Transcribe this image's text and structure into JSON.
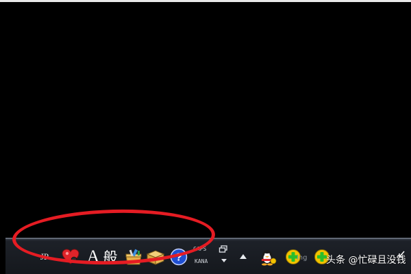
{
  "langbar": {
    "mode_label": "JP",
    "input_char": "A",
    "input_style": "般",
    "caps_line1": "CAPS",
    "caps_line2": "KANA",
    "ime_name_fragment": "ing"
  },
  "icons": {
    "heart": "heart-icon",
    "toolbox": "toolbox-icon",
    "keybox": "keyboard-box-icon",
    "help": "help-icon",
    "restore": "restore-icon",
    "arrow_down": "chevron-down-icon",
    "arrow_up": "chevron-up-icon",
    "qq": "qq-penguin-icon",
    "plus": "plus-icon"
  },
  "watermark": {
    "text": "头条 @忙碌且没钱"
  },
  "colors": {
    "highlight_ring": "#e51c23",
    "desktop": "#000000",
    "help_blue": "#1f4fd1",
    "plus_green": "#2bbd2b",
    "plus_yellow": "#f2c200"
  }
}
